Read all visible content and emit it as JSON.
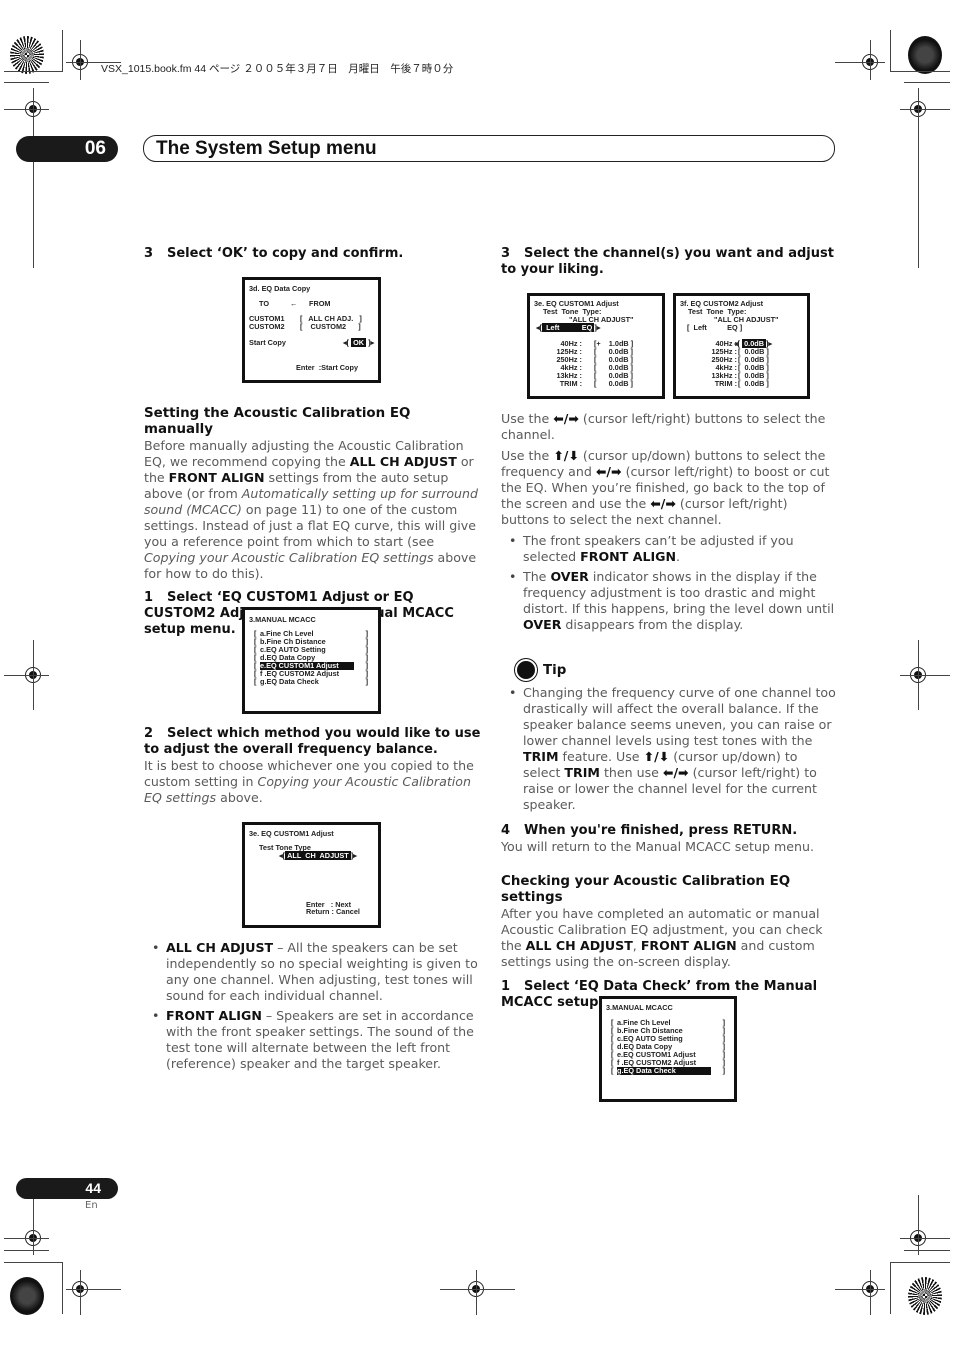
{
  "file_header": "VSX_1015.book.fm  44 ページ  ２００５年３月７日　月曜日　午後７時０分",
  "chapter": {
    "number": "06",
    "title": "The System Setup menu"
  },
  "footer": {
    "page_number": "44",
    "language": "En"
  },
  "left": {
    "step3": {
      "num": "3",
      "text": "Select ‘OK’ to copy and confirm."
    },
    "osd_copy": {
      "title": "3d. EQ Data Copy",
      "to": "TO",
      "arrow": "←",
      "from": "FROM",
      "rows": [
        {
          "to": "CUSTOM1",
          "from": "[   ALL CH ADJ.   ]"
        },
        {
          "to": "CUSTOM2",
          "from": "[    CUSTOM2      ]"
        }
      ],
      "start_copy": "Start Copy",
      "ok": "OK",
      "footer": "Enter  :Start Copy"
    },
    "section_heading": "Setting the Acoustic Calibration EQ manually",
    "intro": {
      "t1": "Before manually adjusting the Acoustic Calibration EQ, we recommend copying the ",
      "b1": "ALL CH ADJUST",
      "t2": " or the ",
      "b2": "FRONT ALIGN",
      "t3": " settings from the auto setup above (or from ",
      "i1": "Automatically setting up for surround sound (MCACC)",
      "t4": " on page 11) to one of the custom settings. Instead of just a flat EQ curve, this will give you a reference point from which to start (see ",
      "i2": "Copying your Acoustic Calibration EQ settings",
      "t5": " above for how to do this)."
    },
    "step1": {
      "num": "1",
      "text": "Select ‘EQ CUSTOM1 Adjust or EQ CUSTOM2 Adjust’ from the Manual MCACC setup menu."
    },
    "osd_menu1": {
      "title": "3.MANUAL MCACC",
      "items": [
        "a.Fine Ch Level",
        "b.Fine Ch Distance",
        "c.EQ AUTO Setting",
        "d.EQ Data Copy",
        "e.EQ CUSTOM1 Adjust",
        "f .EQ CUSTOM2 Adjust",
        "g.EQ Data Check"
      ],
      "selected_index": 4
    },
    "step2": {
      "num": "2",
      "text": "Select which method you would like to use to adjust the overall frequency balance.",
      "body_t1": "It is best to choose whichever one you copied to the custom setting in ",
      "body_i1": "Copying your Acoustic Calibration EQ settings",
      "body_t2": " above."
    },
    "osd_tone": {
      "title": "3e. EQ CUSTOM1 Adjust",
      "label": "Test Tone Type",
      "value": "ALL  CH  ADJUST",
      "enter": "Enter   : Next",
      "return": "Return : Cancel"
    },
    "bullets": [
      {
        "bold": "ALL CH ADJUST",
        "text": " – All the speakers can be set independently so no special weighting is given to any one channel. When adjusting, test tones will sound for each individual channel."
      },
      {
        "bold": "FRONT ALIGN",
        "text": " – Speakers are set in accordance with the front speaker settings. The sound of the test tone will alternate between the left front (reference) speaker and the target speaker."
      }
    ]
  },
  "right": {
    "step3": {
      "num": "3",
      "text": "Select the channel(s) you want and adjust to your liking."
    },
    "osd_eq1": {
      "title": "3e. EQ CUSTOM1 Adjust",
      "type_label": "Test  Tone  Type:",
      "type_value": "\"ALL CH ADJUST\"",
      "channel": "Left",
      "mode": "EQ",
      "bands": [
        {
          "freq": "40Hz :",
          "val": "[+    1.0dB ]"
        },
        {
          "freq": "125Hz :",
          "val": "[      0.0dB ]"
        },
        {
          "freq": "250Hz :",
          "val": "[      0.0dB ]"
        },
        {
          "freq": "4kHz :",
          "val": "[      0.0dB ]"
        },
        {
          "freq": "13kHz :",
          "val": "[      0.0dB ]"
        },
        {
          "freq": "TRIM :",
          "val": "[      0.0dB ]"
        }
      ]
    },
    "osd_eq2": {
      "title": "3f. EQ CUSTOM2 Adjust",
      "type_label": "Test  Tone  Type:",
      "type_value": "\"ALL CH ADJUST\"",
      "channel": "[  Left          EQ ]",
      "bands": [
        {
          "freq": "40Hz :",
          "val": "0.0dB"
        },
        {
          "freq": "125Hz :",
          "val": "[  0.0dB ]"
        },
        {
          "freq": "250Hz :",
          "val": "[  0.0dB ]"
        },
        {
          "freq": "4kHz :",
          "val": "[  0.0dB ]"
        },
        {
          "freq": "13kHz :",
          "val": "[  0.0dB ]"
        },
        {
          "freq": "TRIM :",
          "val": "[  0.0dB ]"
        }
      ]
    },
    "p1": {
      "t1": "Use the ",
      "keys": "⬅/➡",
      "t2": " (cursor left/right) buttons to select the channel."
    },
    "p2": {
      "t1": "Use the ",
      "k1": "⬆/⬇",
      "t2": " (cursor up/down) buttons to select the frequency and ",
      "k2": "⬅/➡",
      "t3": " (cursor left/right) to boost or cut the EQ. When you’re finished, go back to the top of the screen and use the ",
      "k3": "⬅/➡",
      "t4": " (cursor left/right) buttons to select the next channel."
    },
    "bullets": [
      {
        "t1": "The front speakers can’t be adjusted if you selected ",
        "b1": "FRONT ALIGN",
        "t2": "."
      },
      {
        "t1": "The ",
        "b1": "OVER",
        "t2": " indicator shows in the display if the frequency adjustment is too drastic and might distort. If this happens, bring the level down until ",
        "b2": "OVER",
        "t3": " disappears from the display."
      }
    ],
    "tip": {
      "heading": "Tip",
      "t1": "Changing the frequency curve of one channel too drastically will affect the overall balance. If the speaker balance seems uneven, you can raise or lower channel levels using test tones with the ",
      "b1": "TRIM",
      "t2": " feature. Use ",
      "k1": "⬆/⬇",
      "t3": " (cursor up/down) to select ",
      "b2": "TRIM",
      "t4": " then use ",
      "k2": "⬅/➡",
      "t5": " (cursor left/right) to raise or lower the channel level for the current speaker."
    },
    "step4": {
      "num": "4",
      "text": "When you're finished, press RETURN.",
      "body": "You will return to the Manual MCACC setup menu."
    },
    "section_heading": "Checking your Acoustic Calibration EQ settings",
    "check_body": {
      "t1": "After you have completed an automatic or manual Acoustic Calibration EQ adjustment, you can check the ",
      "b1": "ALL CH ADJUST",
      "t2": ", ",
      "b2": "FRONT ALIGN",
      "t3": " and custom settings using the on-screen display."
    },
    "step1": {
      "num": "1",
      "text": "Select ‘EQ Data Check’ from the Manual MCACC setup menu."
    },
    "osd_menu2": {
      "title": "3.MANUAL MCACC",
      "items": [
        "a.Fine Ch Level",
        "b.Fine Ch Distance",
        "c.EQ AUTO Setting",
        "d.EQ Data Copy",
        "e.EQ CUSTOM1 Adjust",
        "f .EQ CUSTOM2 Adjust",
        "g.EQ Data Check"
      ],
      "selected_index": 6
    }
  }
}
